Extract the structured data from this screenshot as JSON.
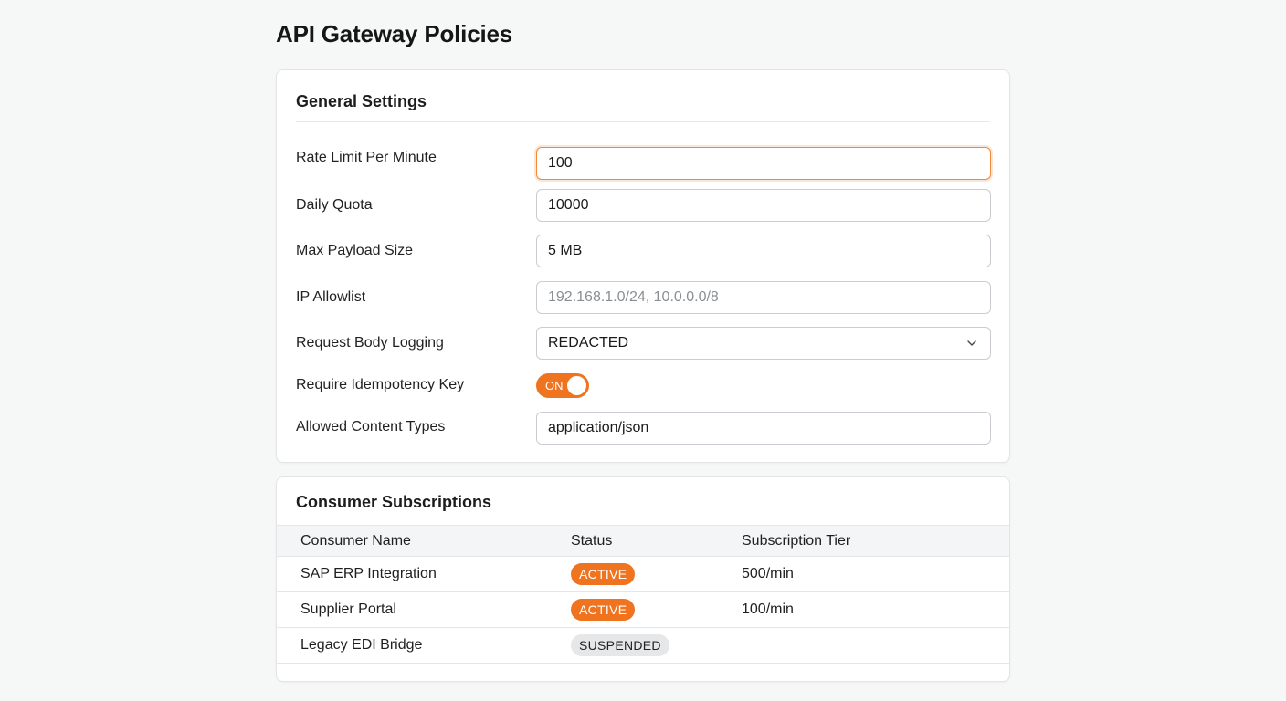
{
  "page": {
    "title": "API Gateway Policies"
  },
  "general": {
    "title": "General Settings",
    "rate_limit": {
      "label": "Rate Limit Per Minute",
      "value": "100"
    },
    "daily_quota": {
      "label": "Daily Quota",
      "value": "10000"
    },
    "max_payload": {
      "label": "Max Payload Size",
      "value": "5 MB"
    },
    "ip_allowlist": {
      "label": "IP Allowlist",
      "value": "",
      "placeholder": "192.168.1.0/24, 10.0.0.0/8"
    },
    "body_logging": {
      "label": "Request Body Logging",
      "value": "REDACTED"
    },
    "idempotency": {
      "label": "Require Idempotency Key",
      "toggle_text": "ON",
      "checked": true
    },
    "content_types": {
      "label": "Allowed Content Types",
      "value": "application/json"
    }
  },
  "subscriptions": {
    "title": "Consumer Subscriptions",
    "columns": [
      "Consumer Name",
      "Status",
      "Subscription Tier"
    ],
    "rows": [
      {
        "name": "SAP ERP Integration",
        "status": "ACTIVE",
        "tier": "500/min"
      },
      {
        "name": "Supplier Portal",
        "status": "ACTIVE",
        "tier": "100/min"
      },
      {
        "name": "Legacy EDI Bridge",
        "status": "SUSPENDED",
        "tier": ""
      }
    ]
  },
  "colors": {
    "accent": "#f07420",
    "focus_border": "#f08a3c",
    "badge_suspended": "#e6e7e9"
  },
  "icons": {
    "select_chevron": "chevron-down-icon"
  }
}
